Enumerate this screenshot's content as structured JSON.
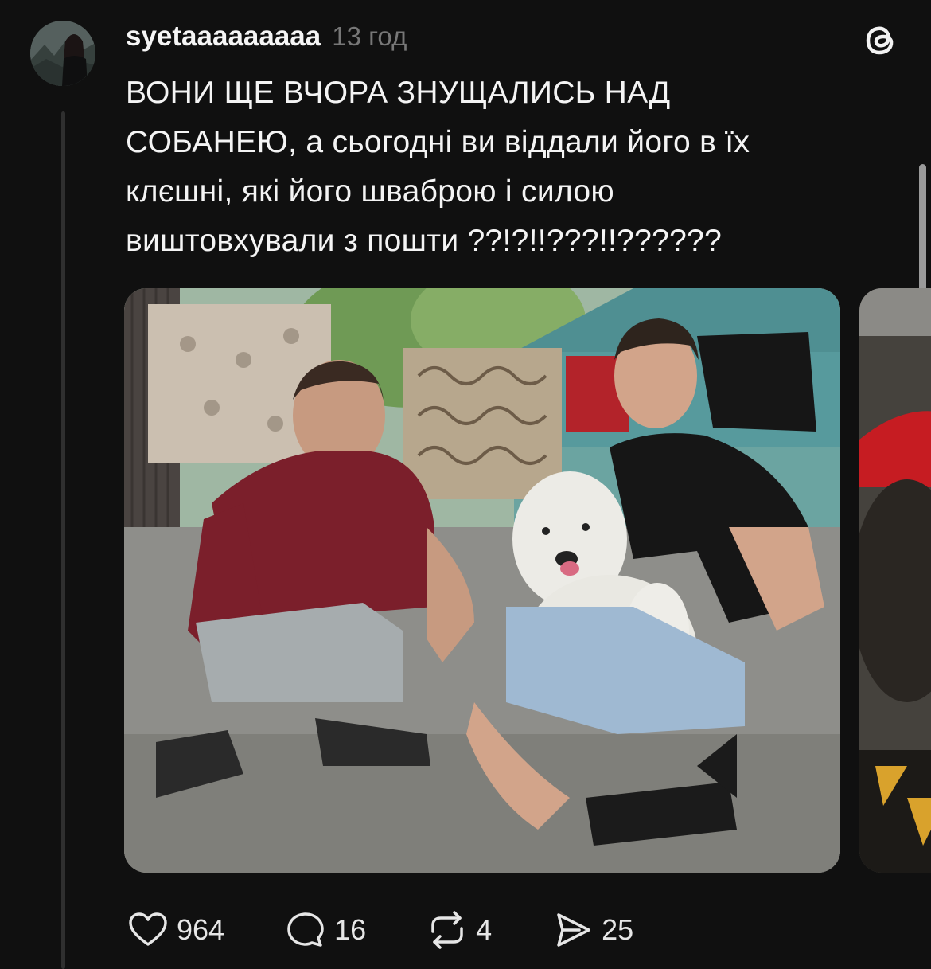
{
  "post": {
    "username": "syetaaaaaaaaa",
    "time": "13 год",
    "text_lines": [
      "ВОНИ ЩЕ ВЧОРА ЗНУЩАЛИСЬ НАД",
      "СОБАНЕЮ, а сьогодні ви віддали його в їх",
      "клєшні, які його шваброю і силою",
      "виштовхували з пошти ??!?!!???!!??????"
    ]
  },
  "icons": {
    "avatar": "profile-photo",
    "app": "threads-logo-icon",
    "like": "heart-icon",
    "reply": "comment-bubble-icon",
    "repost": "repost-arrows-icon",
    "share": "send-paper-plane-icon"
  },
  "actions": {
    "likes": "964",
    "replies": "16",
    "reposts": "4",
    "shares": "25"
  },
  "colors": {
    "background": "#101010",
    "text": "#f4f4f4",
    "muted": "#777777",
    "thread_line": "#2f2f2f"
  }
}
